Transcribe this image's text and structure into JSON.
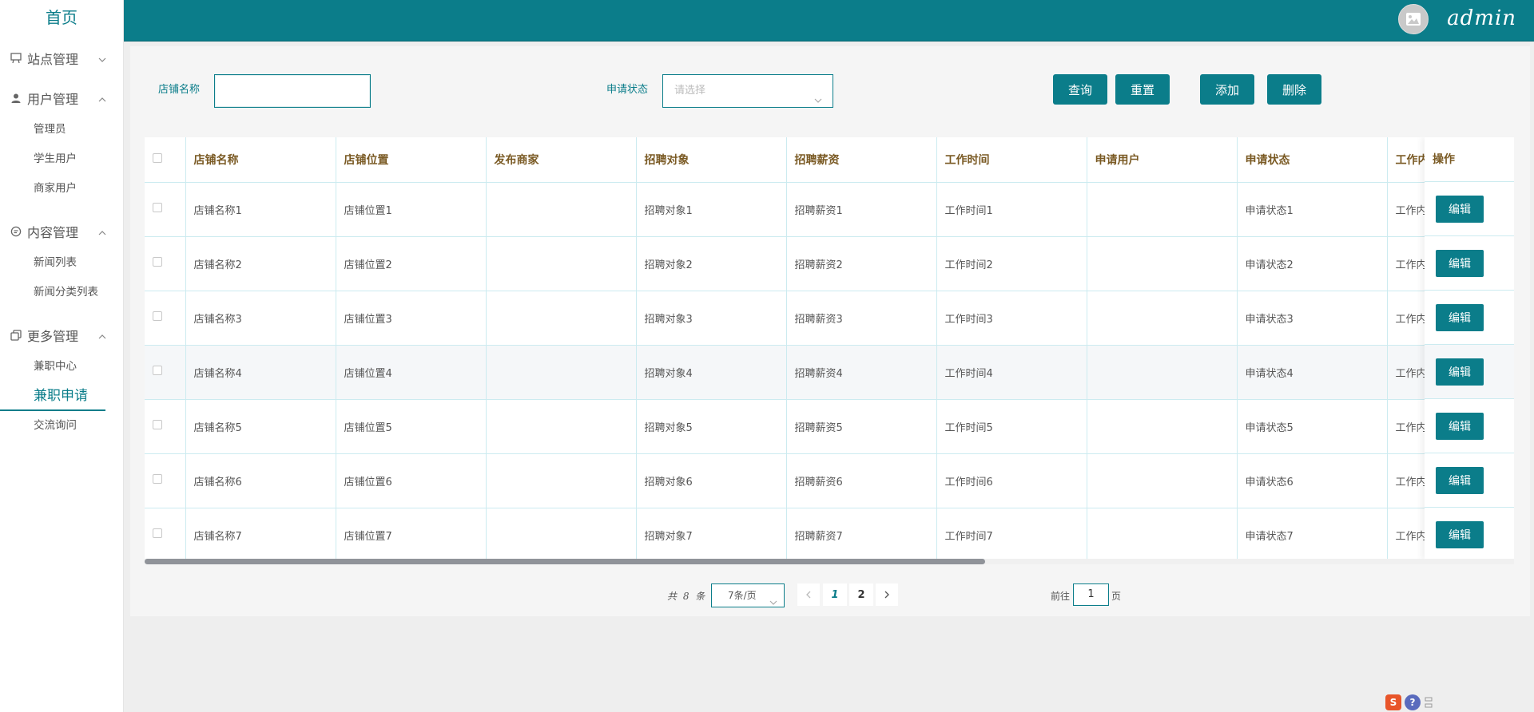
{
  "sidebar": {
    "home": "首页",
    "groups": [
      {
        "label": "站点管理",
        "icon": "board-icon",
        "expanded": false,
        "items": []
      },
      {
        "label": "用户管理",
        "icon": "user-icon",
        "expanded": true,
        "items": [
          "管理员",
          "学生用户",
          "商家用户"
        ]
      },
      {
        "label": "内容管理",
        "icon": "chat-icon",
        "expanded": true,
        "items": [
          "新闻列表",
          "新闻分类列表"
        ]
      },
      {
        "label": "更多管理",
        "icon": "copy-icon",
        "expanded": true,
        "items": [
          "兼职中心",
          "兼职申请",
          "交流询问"
        ]
      }
    ],
    "active_item": "兼职申请"
  },
  "header": {
    "username": "admin",
    "bg_color": "#0b7d8a"
  },
  "search": {
    "shop_name_label": "店铺名称",
    "shop_name_value": "",
    "status_label": "申请状态",
    "status_placeholder": "请选择",
    "query_btn": "查询",
    "reset_btn": "重置",
    "add_btn": "添加",
    "delete_btn": "删除"
  },
  "table": {
    "columns": [
      "店铺名称",
      "店铺位置",
      "发布商家",
      "招聘对象",
      "招聘薪资",
      "工作时间",
      "申请用户",
      "申请状态",
      "工作内"
    ],
    "op_header": "操作",
    "edit_label": "编辑",
    "rows": [
      [
        "店铺名称1",
        "店铺位置1",
        "",
        "招聘对象1",
        "招聘薪资1",
        "工作时间1",
        "",
        "申请状态1",
        "工作内"
      ],
      [
        "店铺名称2",
        "店铺位置2",
        "",
        "招聘对象2",
        "招聘薪资2",
        "工作时间2",
        "",
        "申请状态2",
        "工作内"
      ],
      [
        "店铺名称3",
        "店铺位置3",
        "",
        "招聘对象3",
        "招聘薪资3",
        "工作时间3",
        "",
        "申请状态3",
        "工作内"
      ],
      [
        "店铺名称4",
        "店铺位置4",
        "",
        "招聘对象4",
        "招聘薪资4",
        "工作时间4",
        "",
        "申请状态4",
        "工作内"
      ],
      [
        "店铺名称5",
        "店铺位置5",
        "",
        "招聘对象5",
        "招聘薪资5",
        "工作时间5",
        "",
        "申请状态5",
        "工作内"
      ],
      [
        "店铺名称6",
        "店铺位置6",
        "",
        "招聘对象6",
        "招聘薪资6",
        "工作时间6",
        "",
        "申请状态6",
        "工作内"
      ],
      [
        "店铺名称7",
        "店铺位置7",
        "",
        "招聘对象7",
        "招聘薪资7",
        "工作时间7",
        "",
        "申请状态7",
        "工作内"
      ]
    ]
  },
  "pagination": {
    "total_text": "共 8 条",
    "page_size": "7条/页",
    "pages": [
      "1",
      "2"
    ],
    "current_page": "1",
    "goto_prefix": "前往",
    "goto_value": "1",
    "goto_suffix": "页"
  }
}
